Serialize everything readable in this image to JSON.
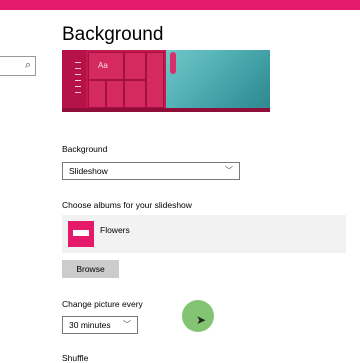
{
  "colors": {
    "accent": "#e51a6b",
    "button_bg": "#cccccc",
    "album_bg": "#f2f2f2"
  },
  "sidebar": {
    "search_icon": "search-icon",
    "search_glyph": "⌕"
  },
  "page": {
    "title": "Background"
  },
  "preview": {
    "sample_text": "Aa"
  },
  "background": {
    "label": "Background",
    "selected": "Slideshow"
  },
  "albums": {
    "label": "Choose albums for your slideshow",
    "items": [
      {
        "name": "Flowers"
      }
    ],
    "browse_label": "Browse"
  },
  "change_picture": {
    "label": "Change picture every",
    "selected": "30 minutes"
  },
  "shuffle": {
    "label": "Shuffle"
  },
  "chevron": "﹀"
}
